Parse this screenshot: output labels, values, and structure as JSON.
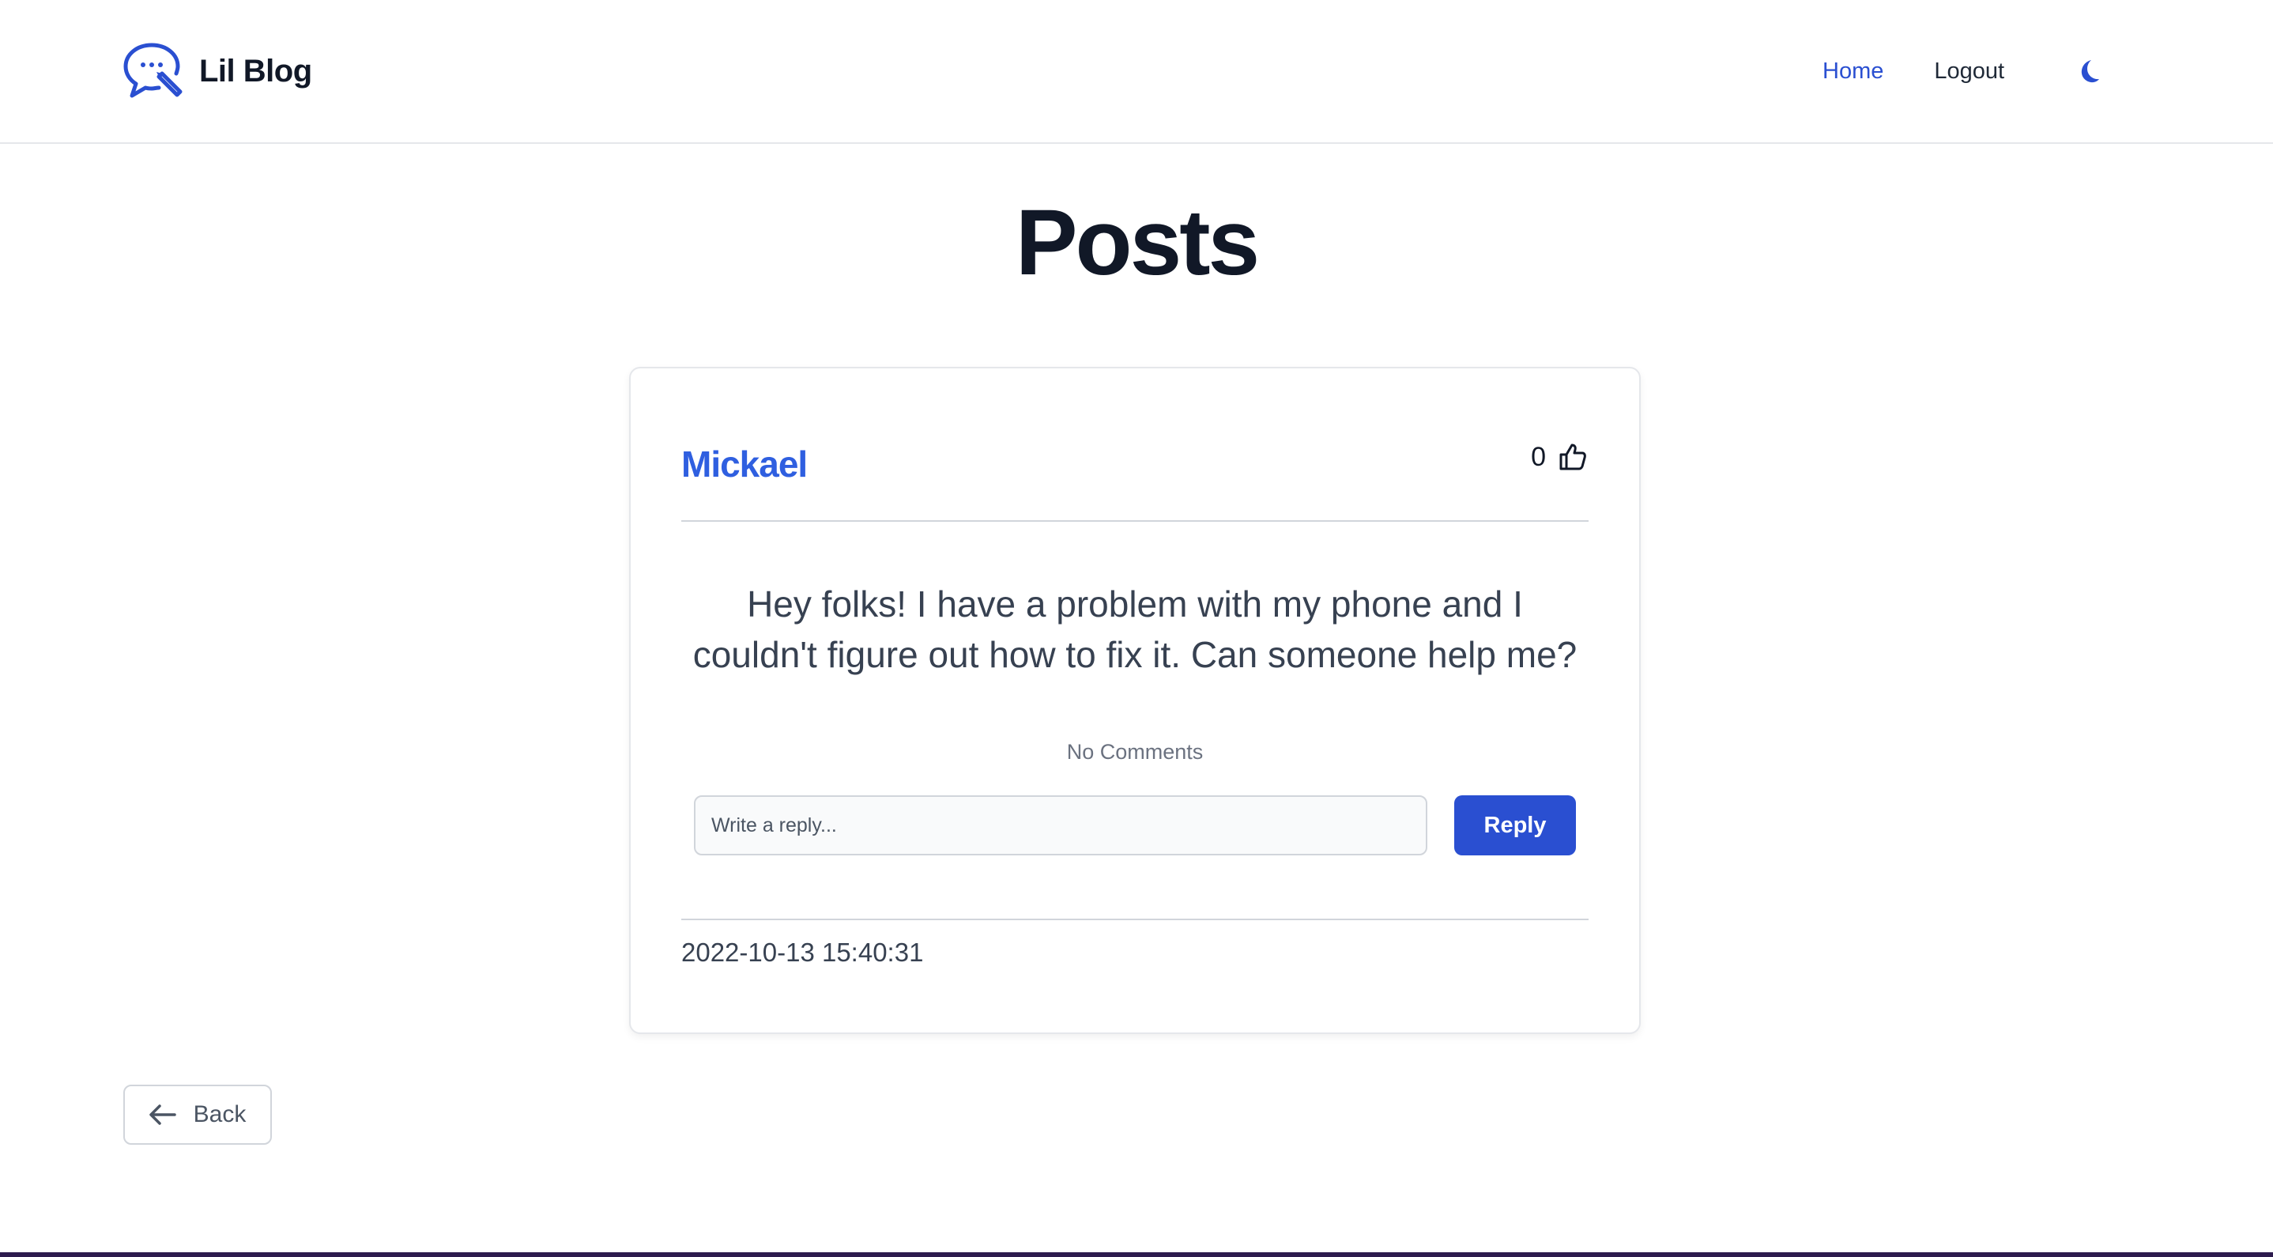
{
  "app": {
    "name": "Lil Blog"
  },
  "nav": {
    "items": [
      {
        "label": "Home",
        "active": true
      },
      {
        "label": "Logout",
        "active": false
      }
    ],
    "theme_toggle_icon": "moon-icon"
  },
  "page": {
    "title": "Posts"
  },
  "post": {
    "author": "Mickael",
    "likes": "0",
    "like_icon": "thumbs-up-icon",
    "body": "Hey folks! I have a problem with my phone and I couldn't figure out how to fix it. Can someone help me?",
    "comments_status": "No Comments",
    "reply": {
      "placeholder": "Write a reply...",
      "value": "",
      "button_label": "Reply"
    },
    "date": "2022-10-13 15:40:31"
  },
  "back": {
    "label": "Back",
    "icon": "arrow-left-icon"
  },
  "colors": {
    "accent": "#2a4fd1",
    "author": "#2f5fe0",
    "text": "#111827",
    "muted": "#6b7280"
  }
}
